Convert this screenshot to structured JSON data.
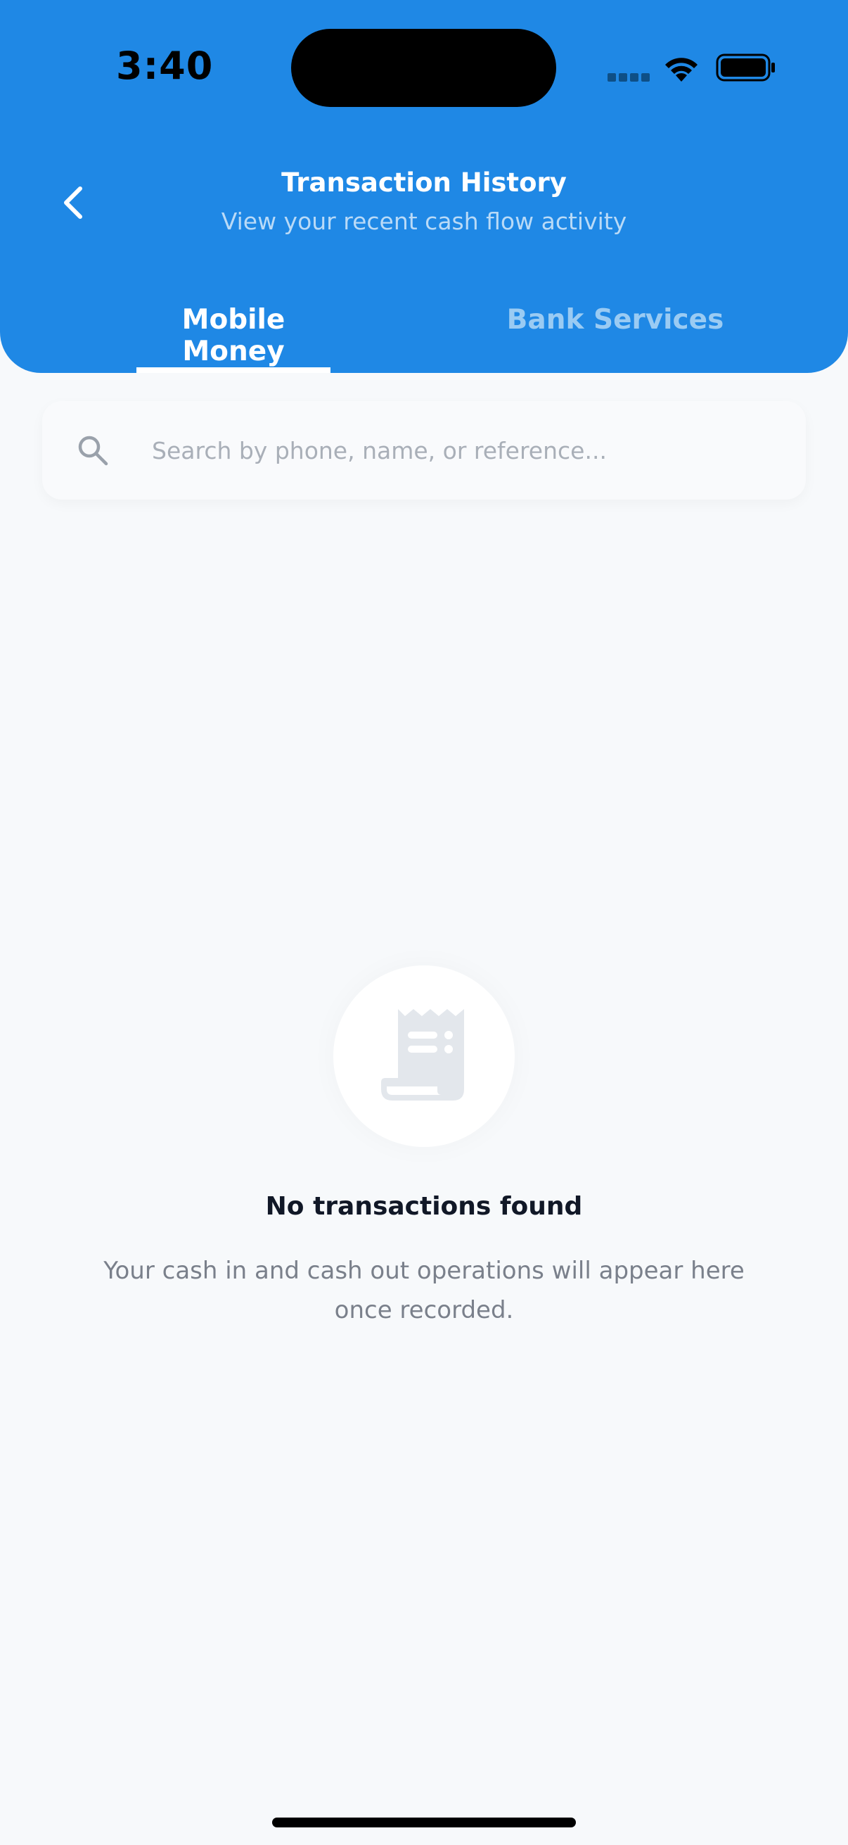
{
  "status_bar": {
    "time": "3:40"
  },
  "header": {
    "title": "Transaction History",
    "subtitle": "View your recent cash flow activity",
    "back_icon": "chevron-left-icon",
    "background_color": "#1F88E5"
  },
  "tabs": [
    {
      "label": "Mobile Money",
      "active": true
    },
    {
      "label": "Bank Services",
      "active": false
    }
  ],
  "search": {
    "placeholder": "Search by phone, name, or reference...",
    "value": "",
    "icon": "search-icon"
  },
  "empty_state": {
    "icon": "receipt-icon",
    "title": "No transactions found",
    "description": "Your cash in and cash out operations will appear here once recorded."
  }
}
